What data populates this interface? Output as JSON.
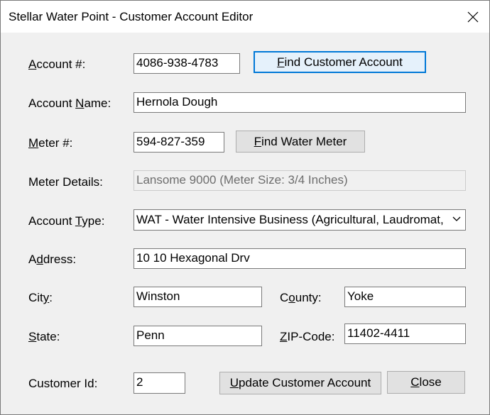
{
  "window": {
    "title": "Stellar Water Point - Customer Account Editor"
  },
  "labels": {
    "account_num": {
      "mn": "A",
      "rest": "ccount #:"
    },
    "account_name": {
      "pre": "Account ",
      "mn": "N",
      "rest": "ame:"
    },
    "meter_num": {
      "mn": "M",
      "rest": "eter #:"
    },
    "meter_details": "Meter Details:",
    "account_type": {
      "pre": "Account ",
      "mn": "T",
      "rest": "ype:"
    },
    "address": {
      "pre": "A",
      "mn": "d",
      "rest": "dress:"
    },
    "city": {
      "pre": "Cit",
      "mn": "y",
      "rest": ":"
    },
    "county": {
      "pre": "C",
      "mn": "o",
      "rest": "unty:"
    },
    "state": {
      "mn": "S",
      "rest": "tate:"
    },
    "zip": {
      "mn": "Z",
      "rest": "IP-Code:"
    },
    "customer_id": "Customer Id:"
  },
  "fields": {
    "account_num": "4086-938-4783",
    "account_name": "Hernola Dough",
    "meter_num": "594-827-359",
    "meter_details": "Lansome 9000 (Meter Size: 3/4 Inches)",
    "account_type": "WAT - Water Intensive Business (Agricultural, Laudromat, etc)",
    "address": "10 10 Hexagonal Drv",
    "city": "Winston",
    "county": "Yoke",
    "state": "Penn",
    "zip": "11402-4411",
    "customer_id": "2"
  },
  "buttons": {
    "find_account": {
      "mn": "F",
      "rest": "ind Customer Account"
    },
    "find_meter": {
      "mn": "F",
      "rest": "ind Water Meter"
    },
    "update": {
      "mn": "U",
      "rest": "pdate Customer Account"
    },
    "close": {
      "mn": "C",
      "rest": "lose"
    }
  },
  "icons": {
    "close_window": "close-icon",
    "dropdown": "chevron-down-icon"
  },
  "colors": {
    "default_button_border": "#0078d7",
    "default_button_bg": "#e5f1fb",
    "dialog_bg": "#f0f0f0"
  }
}
